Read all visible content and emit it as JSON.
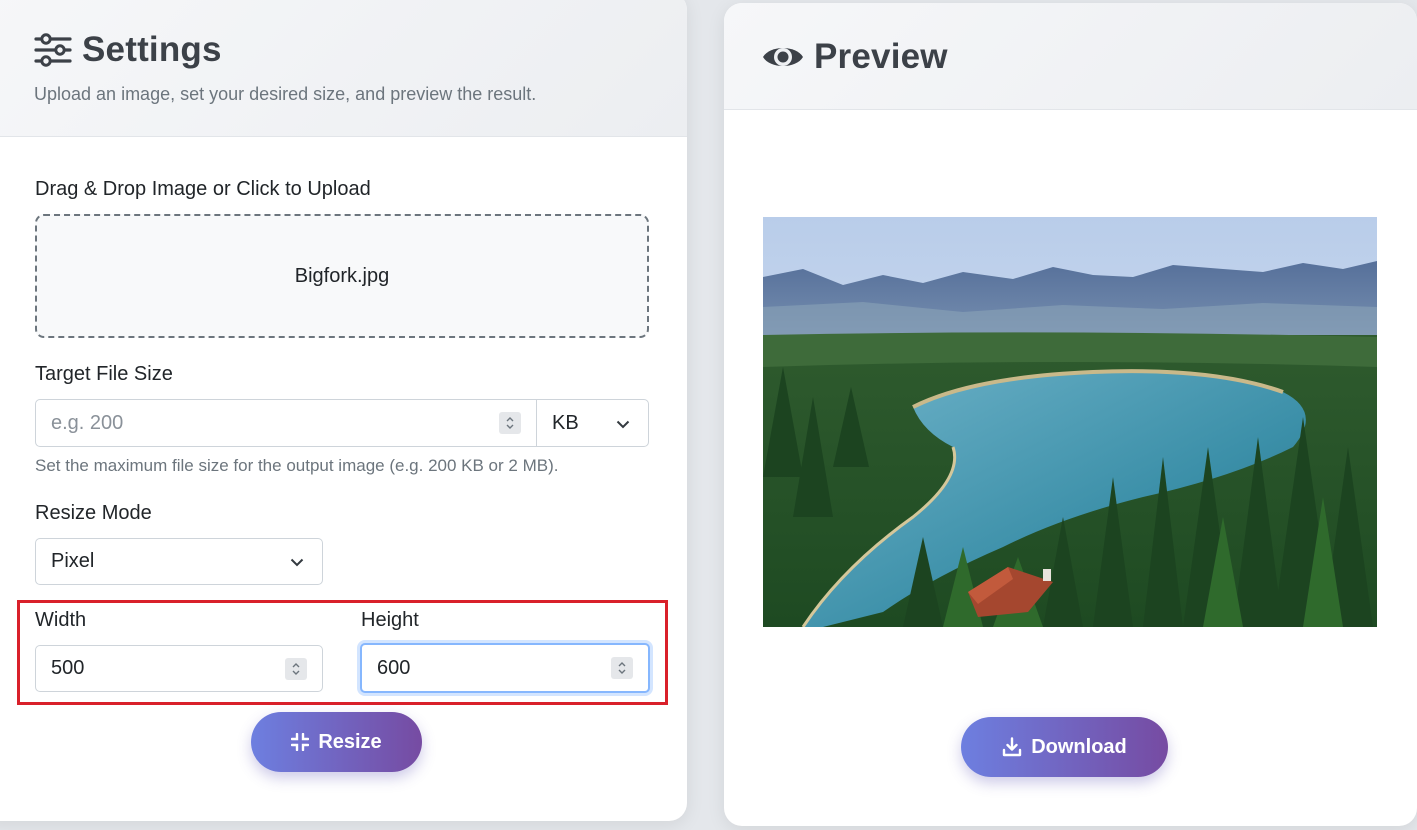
{
  "settings": {
    "title": "Settings",
    "title_icon": "sliders-icon",
    "subtitle": "Upload an image, set your desired size, and preview the result.",
    "upload_label": "Drag & Drop Image or Click to Upload",
    "uploaded_file": "Bigfork.jpg",
    "target_size_label": "Target File Size",
    "target_size_placeholder": "e.g. 200",
    "target_size_value": "",
    "unit_value": "KB",
    "target_size_help": "Set the maximum file size for the output image (e.g. 200 KB or 2 MB).",
    "resize_mode_label": "Resize Mode",
    "resize_mode_value": "Pixel",
    "width_label": "Width",
    "width_value": "500",
    "height_label": "Height",
    "height_value": "600",
    "resize_button": "Resize"
  },
  "preview": {
    "title": "Preview",
    "title_icon": "eye-icon",
    "image_alt": "Aerial view of a mountain lake surrounded by pine forest",
    "download_button": "Download"
  },
  "colors": {
    "accent_gradient_start": "#6d7fe0",
    "accent_gradient_end": "#764ba2",
    "highlight_border": "#d9202a",
    "focus_border": "#86b7fe"
  }
}
